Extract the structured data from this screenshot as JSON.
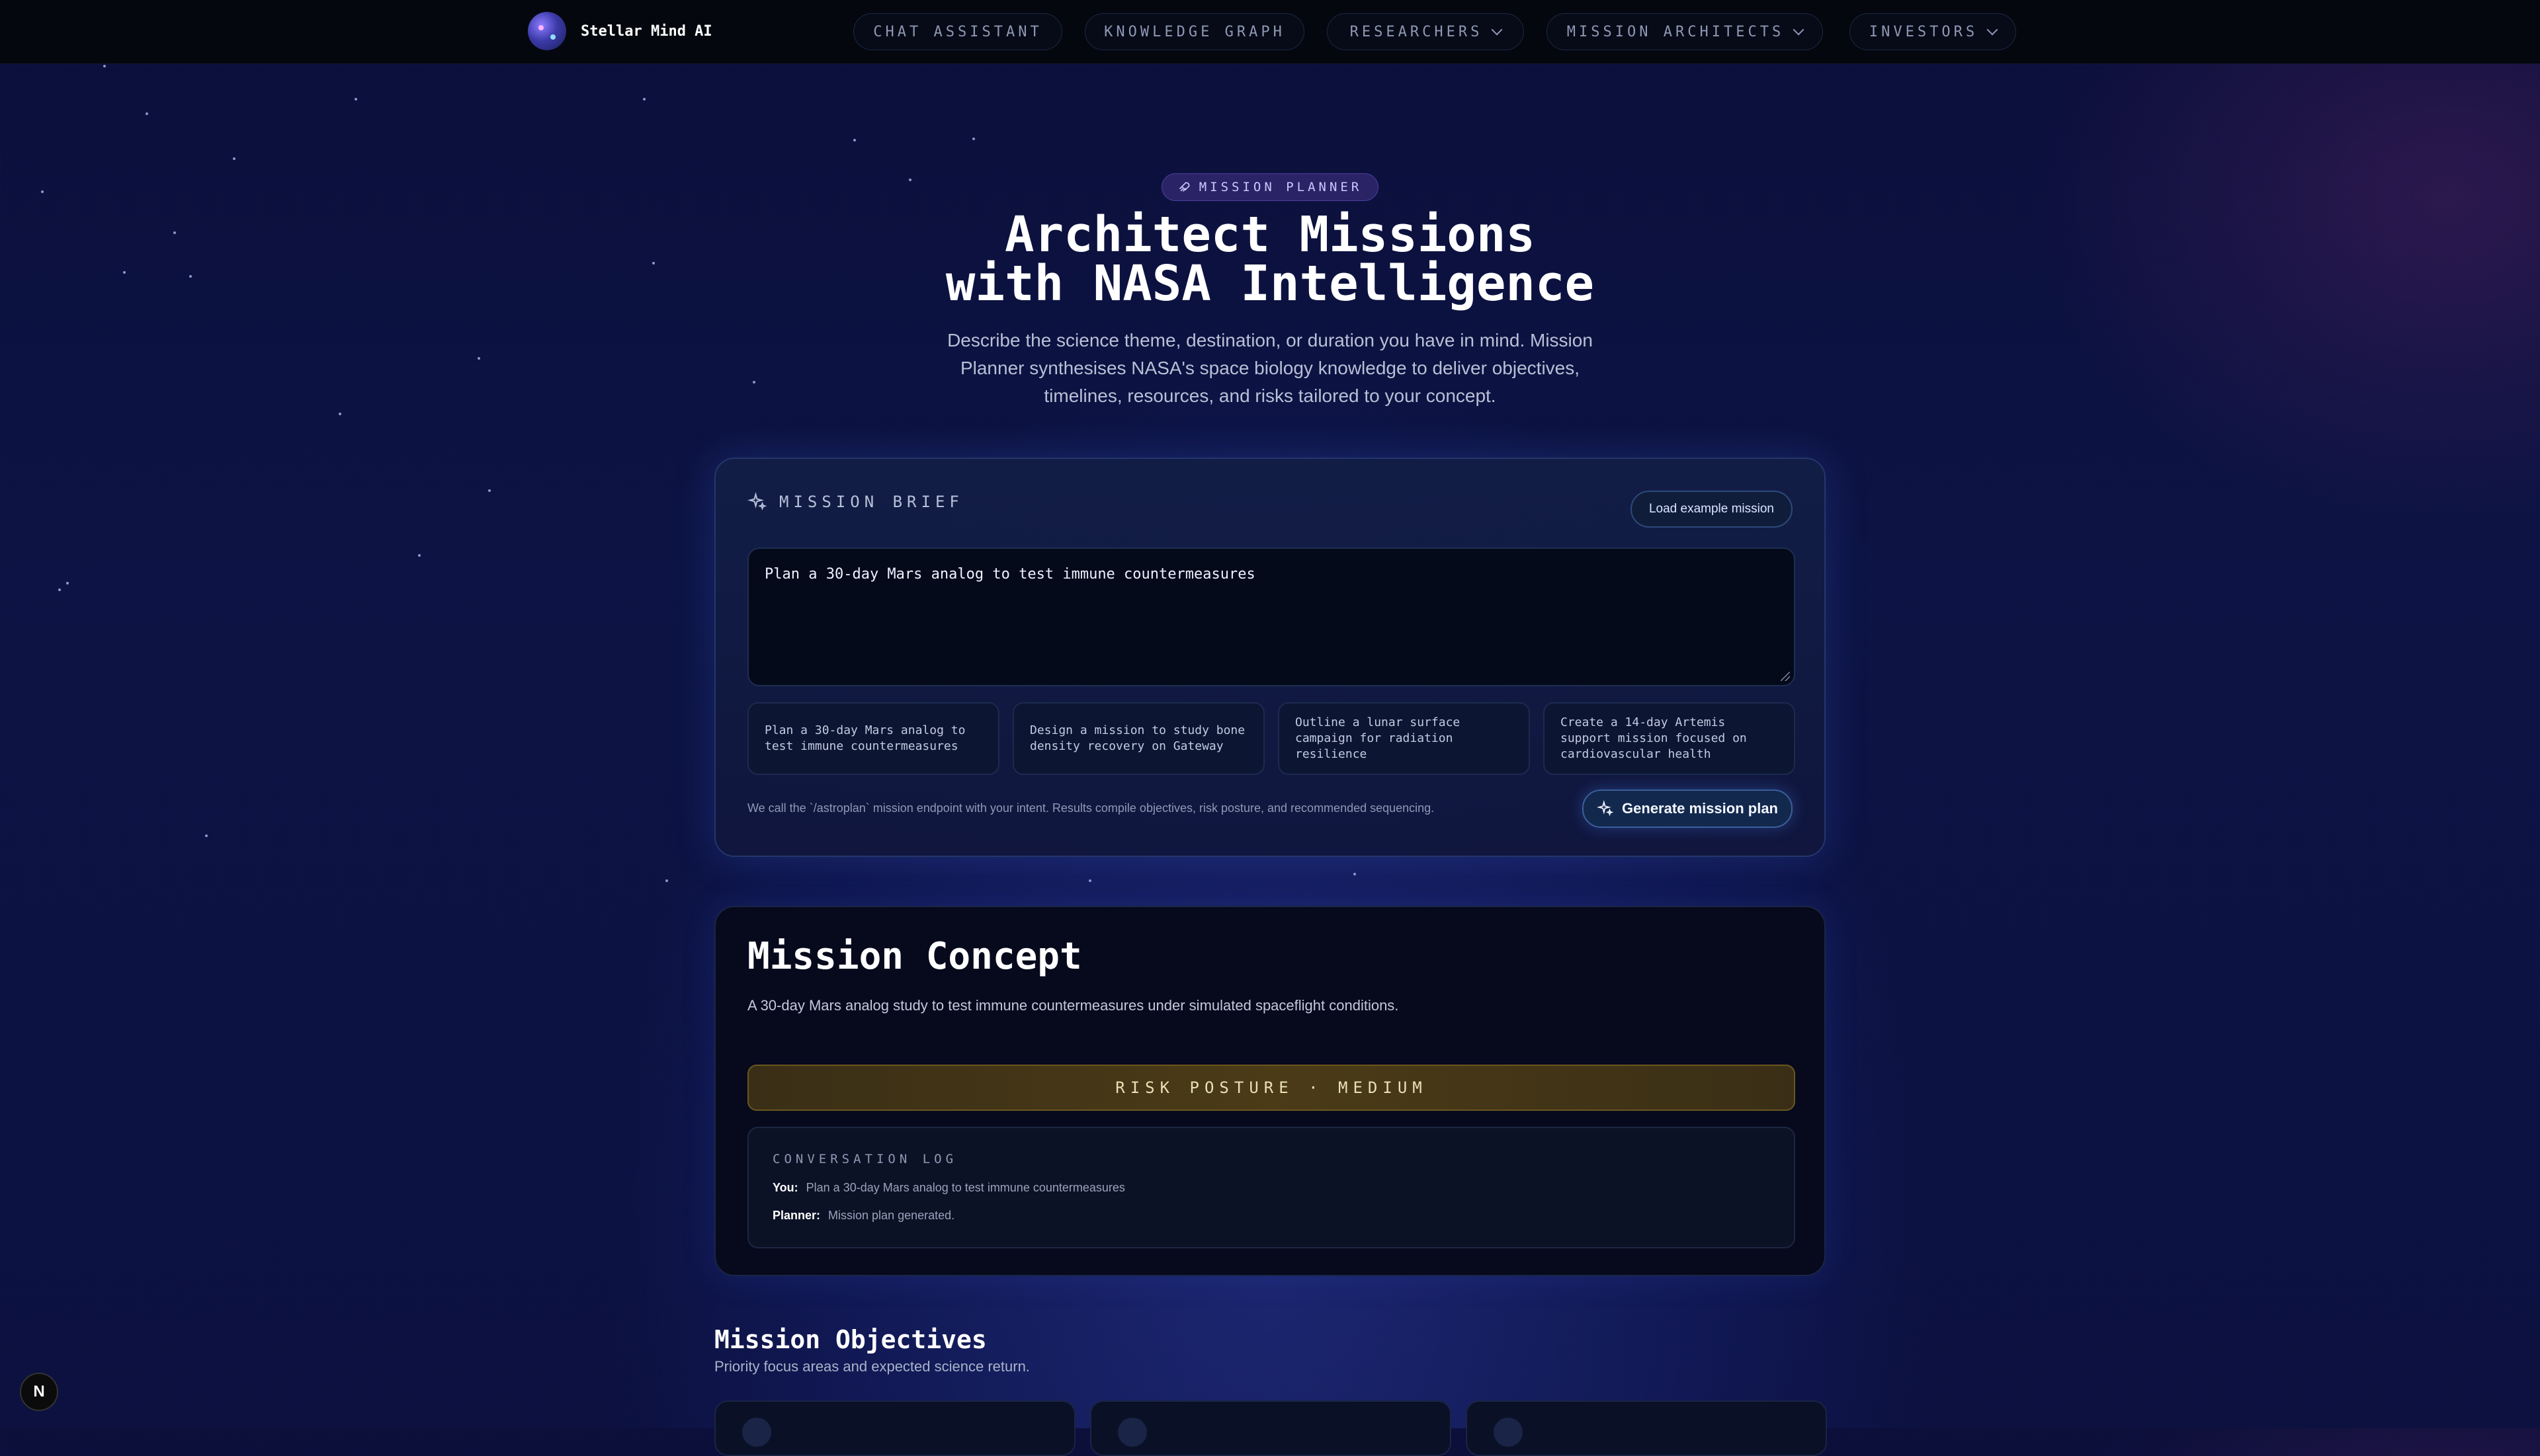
{
  "brand": {
    "name": "Stellar Mind AI"
  },
  "nav": [
    {
      "label": "CHAT ASSISTANT",
      "dropdown": false
    },
    {
      "label": "KNOWLEDGE GRAPH",
      "dropdown": false
    },
    {
      "label": "RESEARCHERS",
      "dropdown": true
    },
    {
      "label": "MISSION ARCHITECTS",
      "dropdown": true
    },
    {
      "label": "INVESTORS",
      "dropdown": true
    }
  ],
  "hero": {
    "badge": "MISSION PLANNER",
    "title_line1": "Architect Missions",
    "title_line2": "with NASA Intelligence",
    "subtitle": "Describe the science theme, destination, or duration you have in mind. Mission Planner synthesises NASA's space biology knowledge to deliver objectives, timelines, resources, and risks tailored to your concept."
  },
  "brief": {
    "heading": "MISSION BRIEF",
    "load_example_label": "Load example mission",
    "input_value": "Plan a 30-day Mars analog to test immune countermeasures",
    "suggestions": [
      "Plan a 30-day Mars analog to test immune countermeasures",
      "Design a mission to study bone density recovery on Gateway",
      "Outline a lunar surface campaign for radiation resilience",
      "Create a 14-day Artemis support mission focused on cardiovascular health"
    ],
    "note": "We call the `/astroplan` mission endpoint with your intent. Results compile objectives, risk posture, and recommended sequencing.",
    "generate_label": "Generate mission plan"
  },
  "concept": {
    "title": "Mission Concept",
    "description": "A 30-day Mars analog study to test immune countermeasures under simulated spaceflight conditions.",
    "risk": "RISK POSTURE · MEDIUM",
    "log_heading": "CONVERSATION LOG",
    "log": [
      {
        "speaker": "You:",
        "text": "Plan a 30-day Mars analog to test immune countermeasures"
      },
      {
        "speaker": "Planner:",
        "text": "Mission plan generated."
      }
    ]
  },
  "objectives": {
    "title": "Mission Objectives",
    "subtitle": "Priority focus areas and expected science return."
  },
  "dev_badge": "N"
}
